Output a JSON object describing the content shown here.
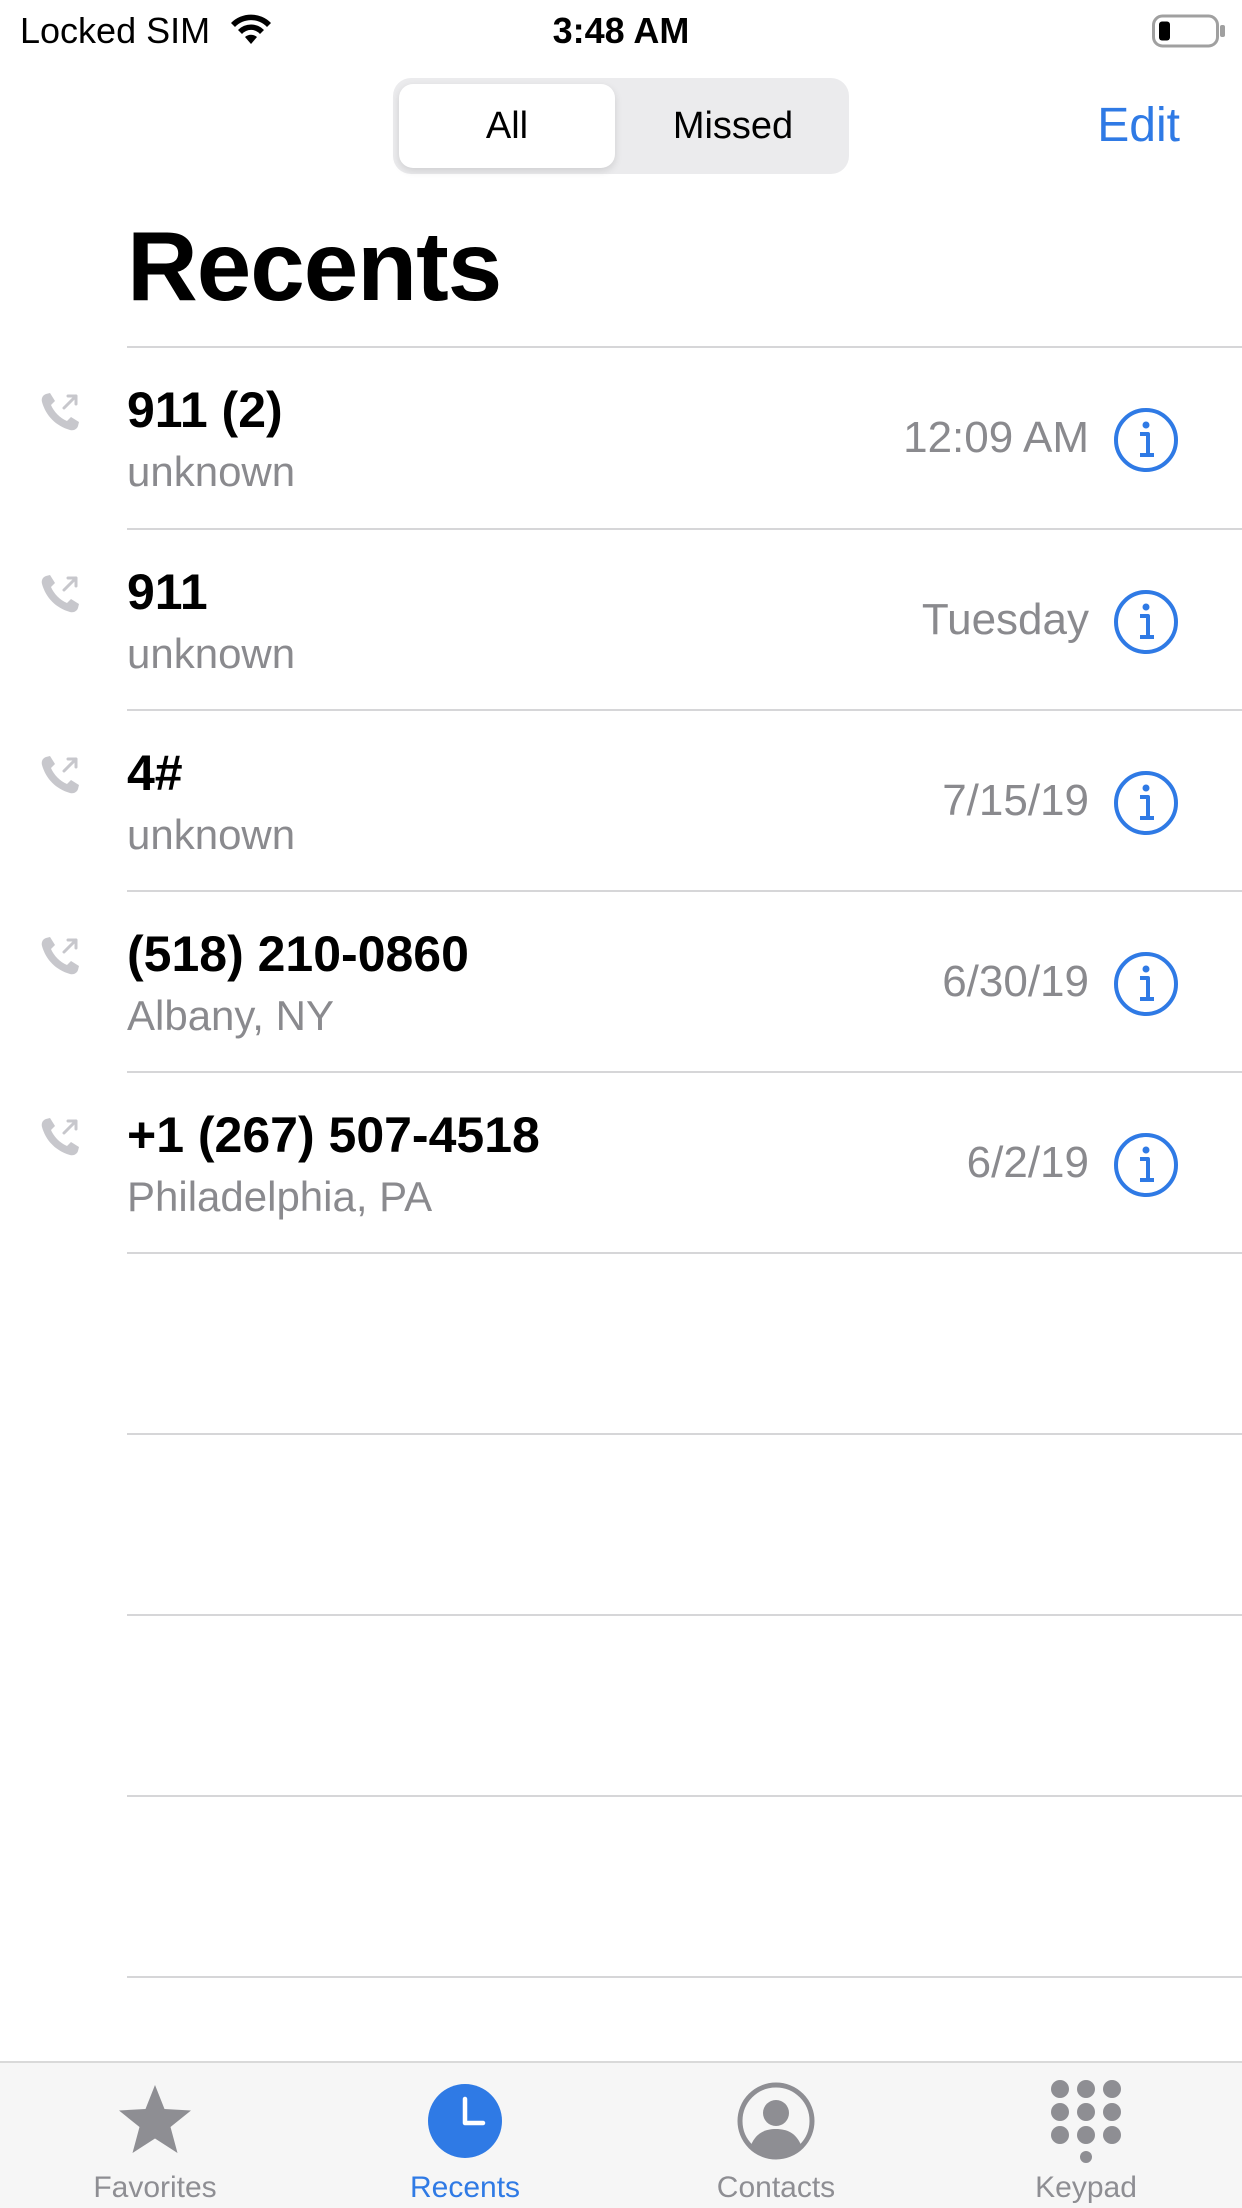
{
  "status_bar": {
    "carrier": "Locked SIM",
    "time": "3:48 AM",
    "wifi_icon": "wifi-icon",
    "battery_icon": "battery-low-icon"
  },
  "segmented_control": {
    "options": [
      "All",
      "Missed"
    ],
    "selected": "All"
  },
  "header": {
    "edit_label": "Edit",
    "title": "Recents"
  },
  "calls": [
    {
      "name": "911 (2)",
      "sub": "unknown",
      "date": "12:09 AM"
    },
    {
      "name": "911",
      "sub": "unknown",
      "date": "Tuesday"
    },
    {
      "name": "4#",
      "sub": "unknown",
      "date": "7/15/19"
    },
    {
      "name": "(518) 210-0860",
      "sub": "Albany, NY",
      "date": "6/30/19"
    },
    {
      "name": "+1 (267) 507-4518",
      "sub": "Philadelphia, PA",
      "date": "6/2/19"
    }
  ],
  "tabs": [
    {
      "label": "Favorites",
      "icon": "star-icon",
      "active": false
    },
    {
      "label": "Recents",
      "icon": "clock-icon",
      "active": true
    },
    {
      "label": "Contacts",
      "icon": "person-circle-icon",
      "active": false
    },
    {
      "label": "Keypad",
      "icon": "keypad-icon",
      "active": false
    }
  ],
  "colors": {
    "accent": "#2f7ae5",
    "secondary_text": "#8a8a8e",
    "separator": "#d6d6d8"
  }
}
